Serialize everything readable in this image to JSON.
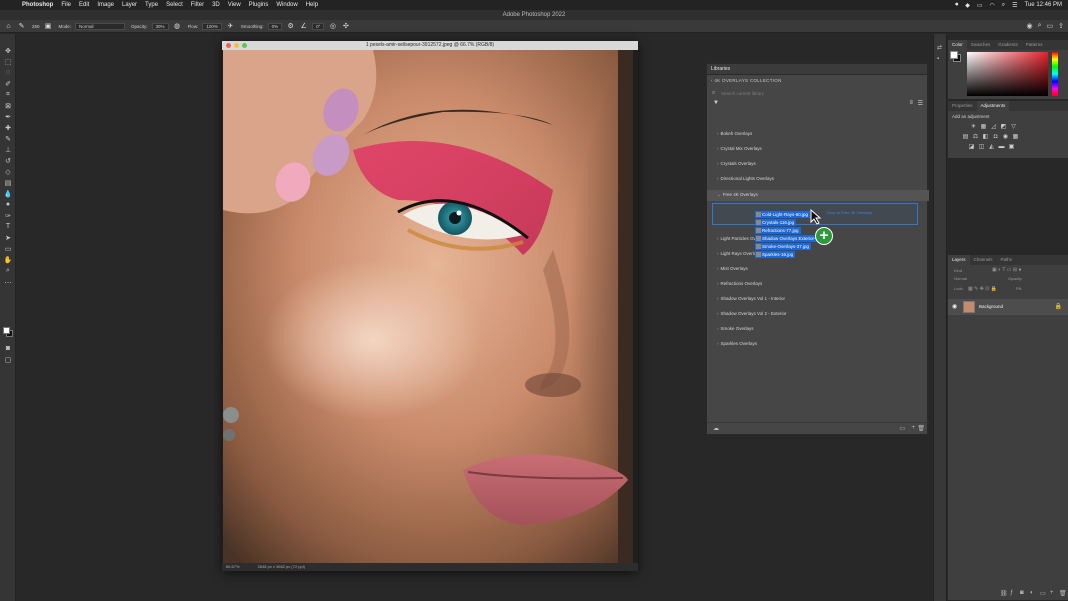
{
  "menubar": {
    "app_name": "Photoshop",
    "items": [
      "File",
      "Edit",
      "Image",
      "Layer",
      "Type",
      "Select",
      "Filter",
      "3D",
      "View",
      "Plugins",
      "Window",
      "Help"
    ],
    "clock": "Tue 12:46 PM"
  },
  "window_title": "Adobe Photoshop 2022",
  "options": {
    "brush_size": "250",
    "mode_label": "Mode:",
    "mode_value": "Normal",
    "opacity_label": "Opacity:",
    "opacity_value": "30%",
    "flow_label": "Flow:",
    "flow_value": "100%",
    "smoothing_label": "Smoothing:",
    "smoothing_value": "0%",
    "angle_value": "0°"
  },
  "document": {
    "title": "1 pexels-amir-seilsepour-3912572.jpeg @ 66.7% (RGB/8)",
    "zoom": "66.67%",
    "dimensions": "2848 px x 3682 px (72 ppi)"
  },
  "libraries": {
    "tab": "Libraries",
    "collection": "4K OVERLAYS COLLECTION",
    "search_placeholder": "Search current library",
    "groups_before": [
      "Bokeh Overlays",
      "Crystal Mix Overlays",
      "Crystals Overlays",
      "Directional Lights Overlays"
    ],
    "open_group": "Free 4K Overlays",
    "dragged_items": [
      "Cold-Light-Rays-60.jpg",
      "Crystals-116.jpg",
      "Refractions-77.jpg",
      "Shadow Overlays Exterior-...",
      "Smoke-Overlays-37.jpg",
      "Sparkles-16.jpg"
    ],
    "partial_groups": [
      "Light Particles Overlays",
      "Light Rays Overlays"
    ],
    "groups_after": [
      "Mist Overlays",
      "Refractions Overlays",
      "Shadow Overlays Vol 1 - Interior",
      "Shadow Overlays Vol 2 - Exterior",
      "Smoke Overlays",
      "Sparkles Overlays"
    ],
    "drop_hint": "Drop to Free 4K Overlays"
  },
  "color_panel": {
    "tabs": [
      "Color",
      "Swatches",
      "Gradients",
      "Patterns"
    ],
    "foreground": "#ffffff",
    "background": "#111111"
  },
  "properties_panel": {
    "tabs": [
      "Properties",
      "Adjustments"
    ],
    "add_label": "Add an adjustment"
  },
  "layers_panel": {
    "tabs": [
      "Layers",
      "Channels",
      "Paths"
    ],
    "kind_label": "Kind",
    "blend_mode": "Normal",
    "opacity_label": "Opacity:",
    "lock_label": "Lock:",
    "fill_label": "Fill:",
    "layer_name": "Background"
  }
}
